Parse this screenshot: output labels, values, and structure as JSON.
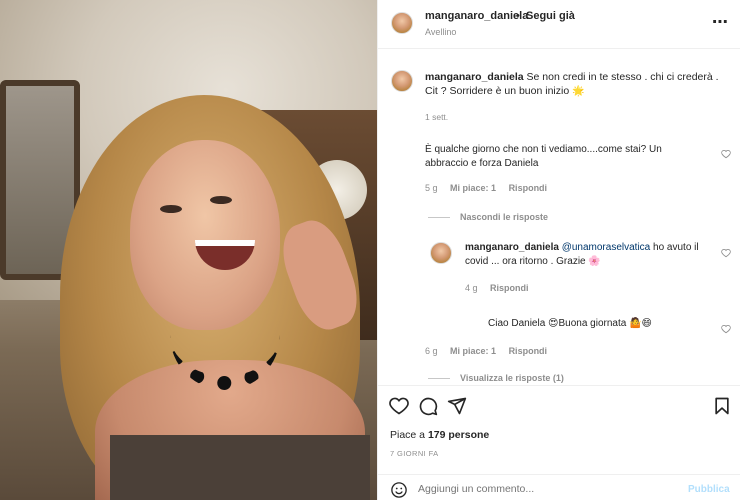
{
  "post": {
    "username": "manganaro_daniela",
    "separator": "•",
    "follow_status": "Segui già",
    "location": "Avellino",
    "more_icon": "more-horizontal-icon"
  },
  "caption": {
    "username": "manganaro_daniela",
    "text": "Se non credi in te stesso . chi ci crederà . Cit ? Sorridere è un buon inizio",
    "emoji": "🌟",
    "time": "1 sett."
  },
  "comments": [
    {
      "text": "È qualche giorno che non ti vediamo....come stai? Un abbraccio e forza Daniela",
      "time": "5 g",
      "likes": "Mi piace: 1",
      "reply_label": "Rispondi"
    },
    {
      "text": "Ciao Daniela",
      "emoji_1": "😍",
      "text_2": "Buona giornata",
      "emoji_2": "🤷😄",
      "time": "6 g",
      "likes": "Mi piace: 1",
      "reply_label": "Rispondi"
    }
  ],
  "hide_replies_label": "Nascondi le risposte",
  "view_replies_label": "Visualizza le risposte (1)",
  "reply": {
    "username": "manganaro_daniela",
    "mention": "@unamoraselvatica",
    "text": "ho avuto il covid ... ora ritorno . Grazie",
    "emoji": "🌸",
    "time": "4 g",
    "reply_label": "Rispondi"
  },
  "footer": {
    "likes_prefix": "Piace a ",
    "likes_count": "179 persone",
    "date": "7 GIORNI FA",
    "comment_placeholder": "Aggiungi un commento...",
    "publish_label": "Pubblica"
  },
  "colors": {
    "text": "#262626",
    "secondary": "#8e8e8e",
    "border": "#efefef",
    "publish_disabled": "#b2dffc",
    "mention": "#00376b"
  }
}
